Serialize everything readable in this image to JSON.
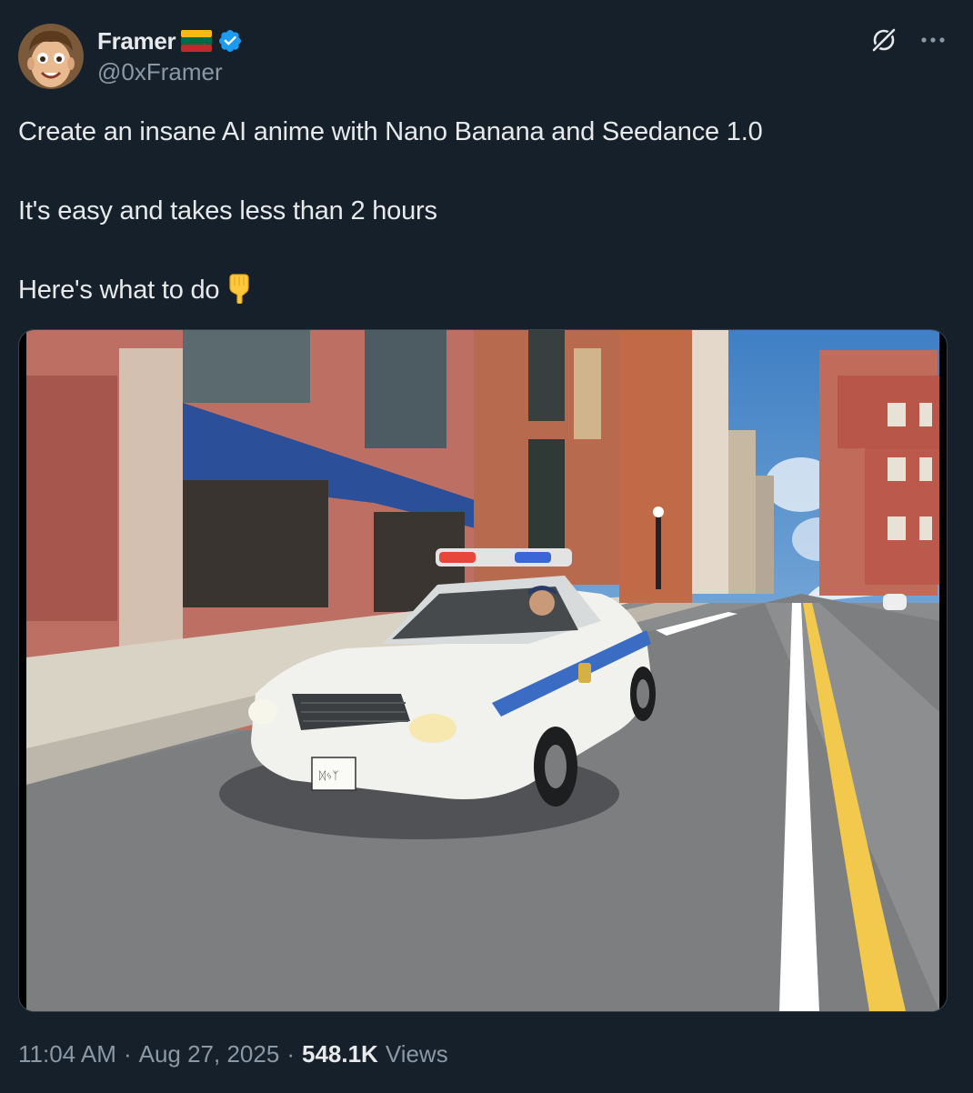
{
  "author": {
    "display_name": "Framer",
    "handle": "@0xFramer",
    "flag_icon": "lithuania-flag-icon",
    "verified_icon": "verified-badge-icon",
    "verified_color": "#1d9bf0"
  },
  "header_actions": {
    "grok_icon": "grok-icon",
    "more_icon": "more-icon"
  },
  "tweet": {
    "lines": [
      "Create an insane AI anime with Nano Banana and Seedance 1.0",
      "It's easy and takes less than 2 hours",
      "Here's what to do"
    ],
    "emoji": "backhand-index-pointing-down-icon"
  },
  "media": {
    "type": "video",
    "icon": "anime-police-car-street-image"
  },
  "meta": {
    "time": "11:04 AM",
    "separator": "·",
    "date": "Aug 27, 2025",
    "views_count": "548.1K",
    "views_label": "Views"
  },
  "colors": {
    "background": "#15202b",
    "text": "#e7e9ea",
    "secondary_text": "#8b98a5",
    "accent": "#1d9bf0"
  }
}
